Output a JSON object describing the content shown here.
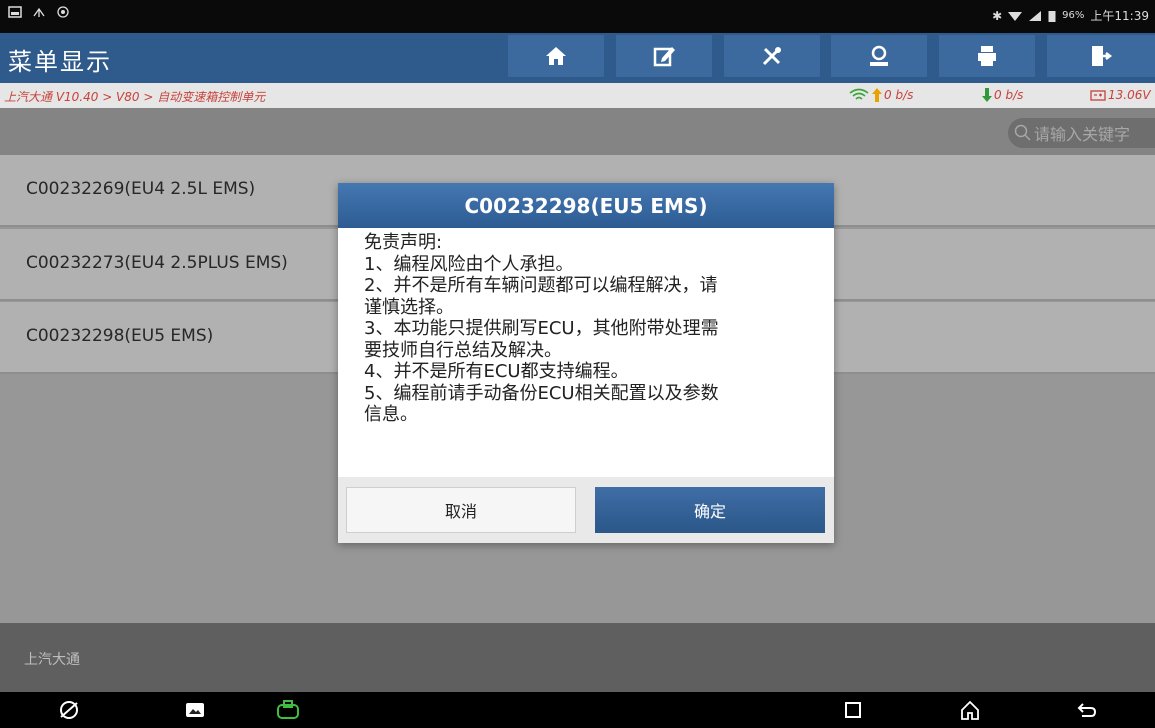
{
  "status_bar": {
    "battery": "96%",
    "time": "上午11:39",
    "icons": [
      "notification-icon",
      "usb-icon",
      "settings-icon",
      "bluetooth-icon",
      "wifi-icon",
      "signal-icon",
      "battery-icon"
    ]
  },
  "header": {
    "title": "菜单显示",
    "toolbar": [
      "home-icon",
      "edit-icon",
      "tools-icon",
      "user-icon",
      "print-icon",
      "exit-icon"
    ],
    "colors": {
      "header_bg": "#2f5a8c",
      "button_bg": "#3c6a9e"
    }
  },
  "breadcrumb": {
    "path": "上汽大通 V10.40 > V80 > 自动变速箱控制单元",
    "upload_rate": "0 b/s",
    "download_rate": "0 b/s",
    "voltage": "13.06V"
  },
  "search": {
    "placeholder": "请输入关键字"
  },
  "list": {
    "items": [
      {
        "label": "C00232269(EU4 2.5L EMS)"
      },
      {
        "label": "C00232273(EU4 2.5PLUS EMS)"
      },
      {
        "label": "C00232298(EU5 EMS)"
      }
    ]
  },
  "footer": {
    "label": "上汽大通"
  },
  "dialog": {
    "title": "C00232298(EU5 EMS)",
    "lines": [
      "免责声明:",
      "1、编程风险由个人承担。",
      "2、并不是所有车辆问题都可以编程解决，请",
      "谨慎选择。",
      "3、本功能只提供刷写ECU，其他附带处理需",
      "要技师自行总结及解决。",
      "4、并不是所有ECU都支持编程。",
      "5、编程前请手动备份ECU相关配置以及参数",
      "信息。"
    ],
    "cancel_label": "取消",
    "ok_label": "确定"
  },
  "navbar": {
    "icons": [
      "browser-icon",
      "gallery-icon",
      "vci-icon",
      "recents-icon",
      "home-icon",
      "back-icon"
    ]
  }
}
